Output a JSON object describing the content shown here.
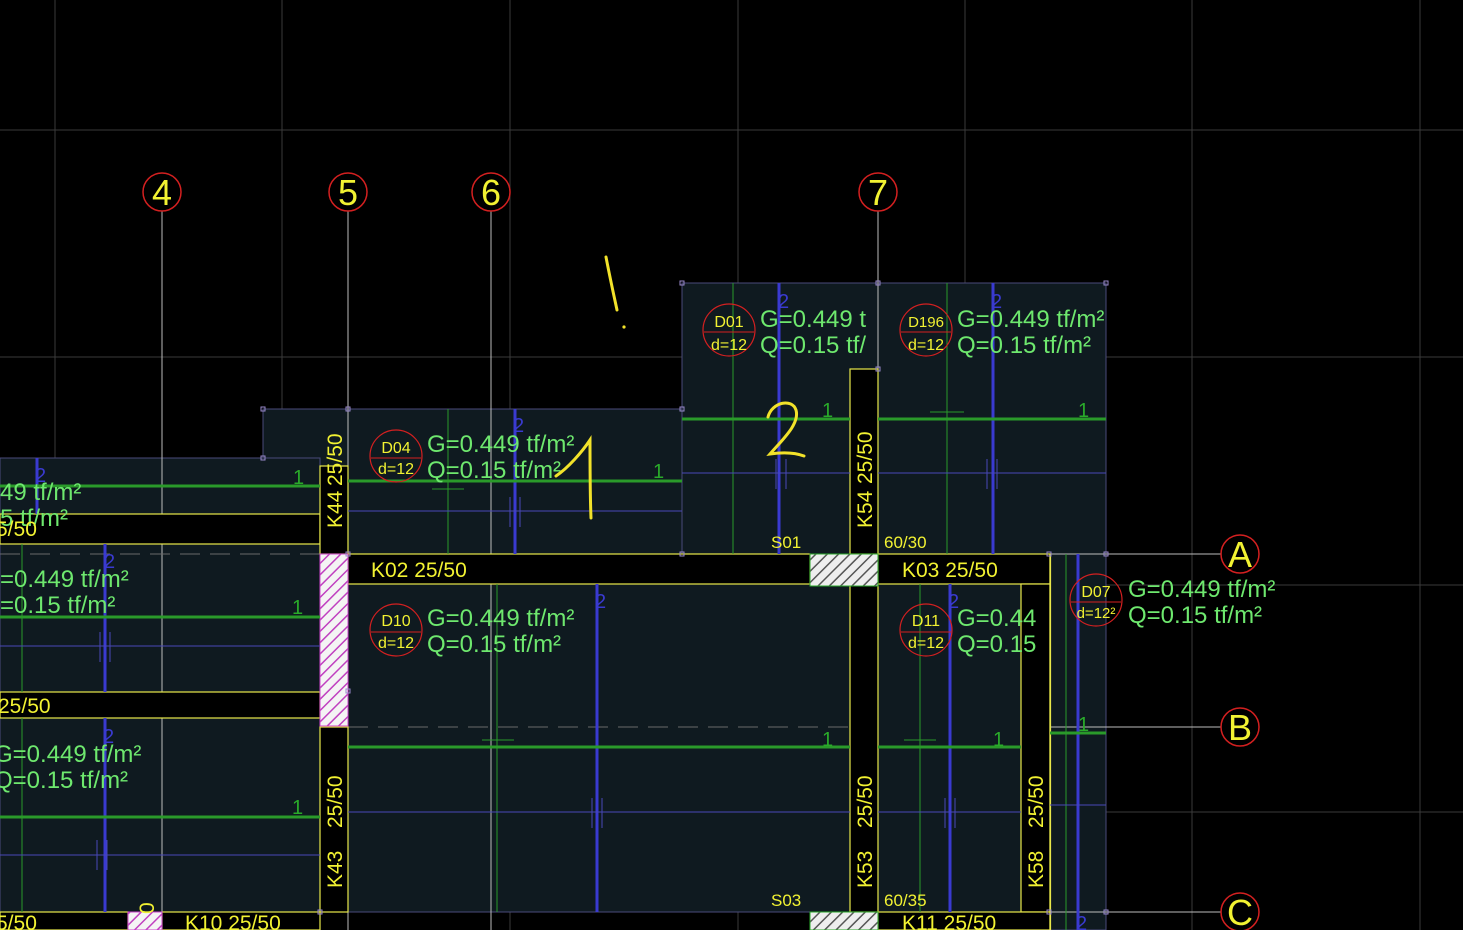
{
  "axes": {
    "vertical": [
      "4",
      "5",
      "6",
      "7"
    ],
    "horizontal": [
      "A",
      "B",
      "C"
    ]
  },
  "slabs": [
    {
      "id": "D01",
      "thickness": "d=12",
      "g": "G=0.449 t",
      "q": "Q=0.15 tf/"
    },
    {
      "id": "D196",
      "thickness": "d=12",
      "g": "G=0.449 tf/m²",
      "q": "Q=0.15 tf/m²"
    },
    {
      "id": "D04",
      "thickness": "d=12",
      "g": "G=0.449 tf/m²",
      "q": "Q=0.15 tf/m²"
    },
    {
      "id": "D10",
      "thickness": "d=12",
      "g": "G=0.449 tf/m²",
      "q": "Q=0.15 tf/m²"
    },
    {
      "id": "D11",
      "thickness": "d=12",
      "g": "G=0.44",
      "q": "Q=0.15"
    },
    {
      "id": "D07",
      "thickness": "d=12²",
      "g": "G=0.449 tf/m²",
      "q": "Q=0.15 tf/m²"
    }
  ],
  "partial_loads": {
    "left_top_g": "49 tf/m²",
    "left_top_q": "5 tf/m²",
    "left_top_beam": "5/50",
    "left_mid_g": "=0.449 tf/m²",
    "left_mid_q": "=0.15 tf/m²",
    "left_bot_g": "G=0.449 tf/m²",
    "left_bot_q": "Q=0.15 tf/m²"
  },
  "beams": {
    "k02": "K02   25/50",
    "k03": "K03 25/50",
    "k44_name": "K44",
    "k44_size": "25/50",
    "k54_name": "K54",
    "k54_size": "25/50",
    "k43_name": "K43",
    "k43_size": "25/50",
    "k53_name": "K53",
    "k53_size": "25/50",
    "k58_name": "K58",
    "k58_size": "25/50",
    "left_beam": "25/50",
    "bottom_left": "5/50",
    "k10": "K10   25/50",
    "k11": "K11 25/50",
    "bottom_col_label": "0"
  },
  "columns": {
    "s01": "S01",
    "s01_size": "60/30",
    "s03": "S03",
    "s03_size": "60/35"
  },
  "span_markers": {
    "one": "1",
    "two": "2"
  },
  "handwritten": [
    "!",
    "2",
    "1"
  ]
}
